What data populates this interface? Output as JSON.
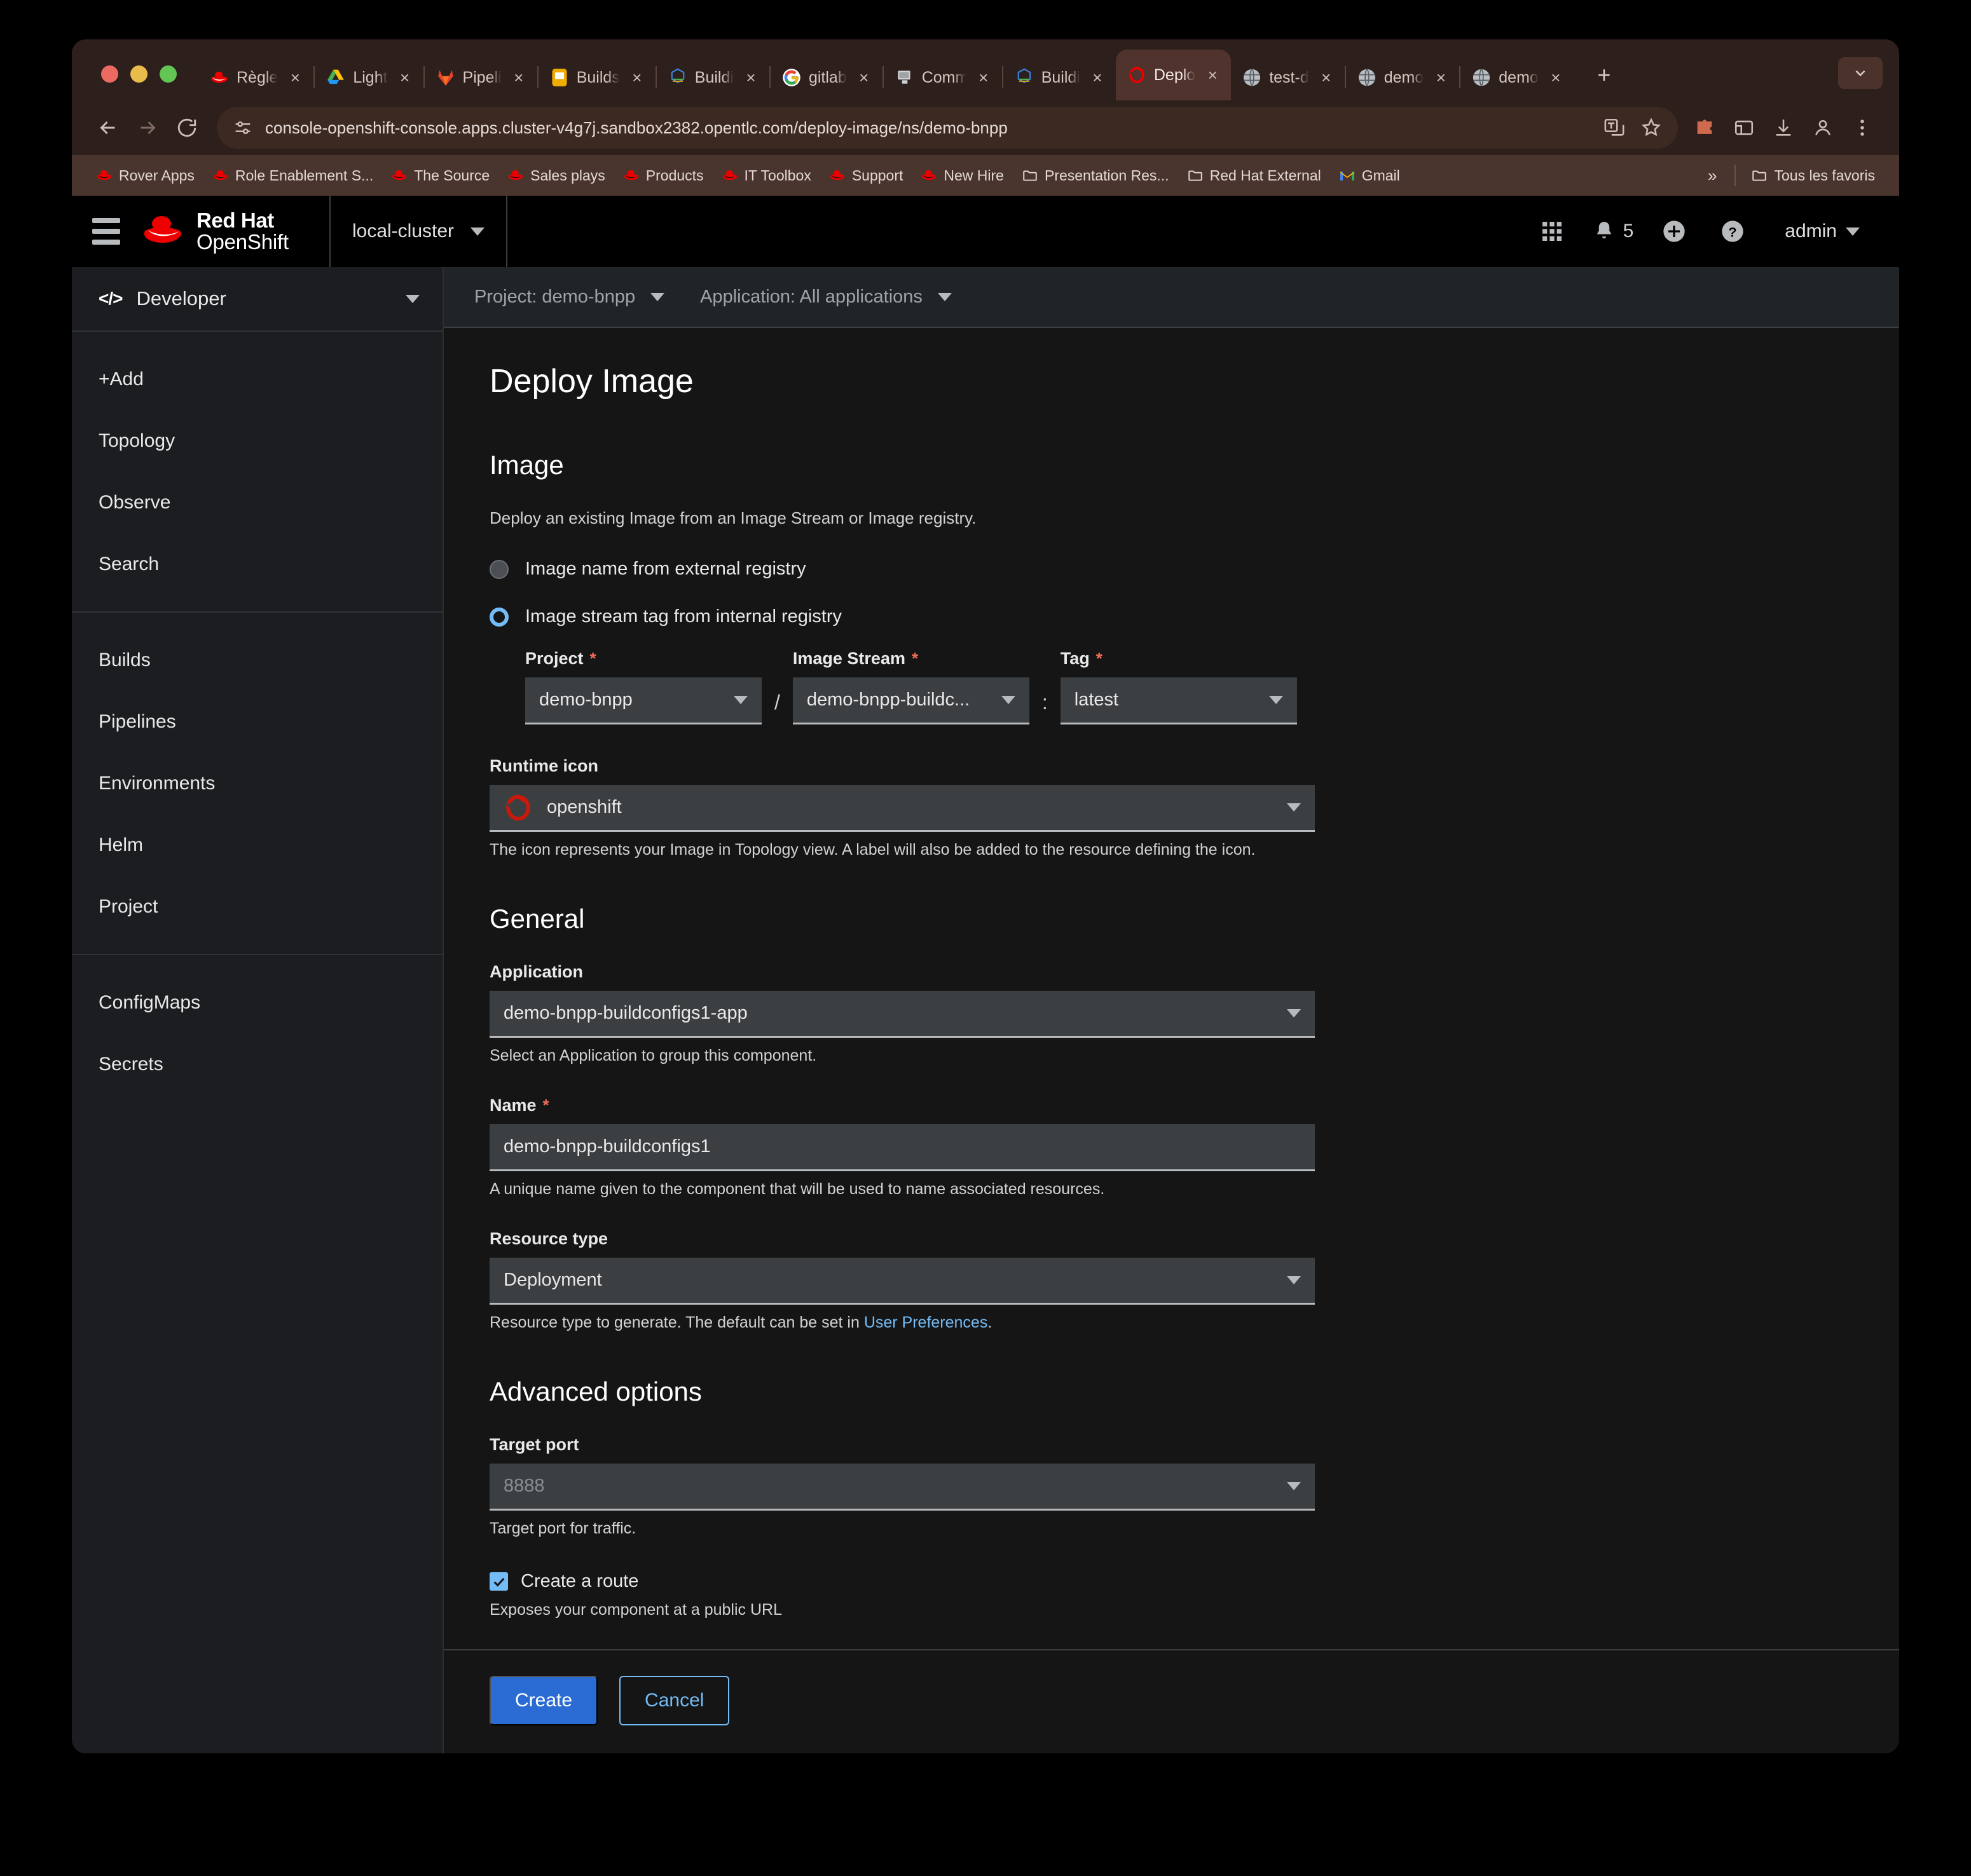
{
  "browser": {
    "tabs": [
      {
        "title": "Règle",
        "favicon": "redhat-icon",
        "active": false
      },
      {
        "title": "Light",
        "favicon": "google-drive-icon",
        "active": false
      },
      {
        "title": "Pipeli",
        "favicon": "gitlab-icon",
        "active": false
      },
      {
        "title": "Builds",
        "favicon": "yellow-note-icon",
        "active": false
      },
      {
        "title": "Buildi",
        "favicon": "tekton-icon",
        "active": false
      },
      {
        "title": "gitlab",
        "favicon": "google-icon",
        "active": false
      },
      {
        "title": "Comm",
        "favicon": "monitor-icon",
        "active": false
      },
      {
        "title": "Buildi",
        "favicon": "tekton-icon",
        "active": false
      },
      {
        "title": "Deplo",
        "favicon": "openshift-icon",
        "active": true
      },
      {
        "title": "test-d",
        "favicon": "globe-icon",
        "active": false
      },
      {
        "title": "demo",
        "favicon": "globe-icon",
        "active": false
      },
      {
        "title": "demo",
        "favicon": "globe-icon",
        "active": false
      }
    ],
    "new_tab_label": "+",
    "nav": {
      "back": "←",
      "forward": "→",
      "reload": "⟳"
    },
    "url": "console-openshift-console.apps.cluster-v4g7j.sandbox2382.opentlc.com/deploy-image/ns/demo-bnpp",
    "omnibox_icons": [
      "translate-icon",
      "bookmark-star-icon"
    ],
    "toolbar_icons": [
      "extension-puzzle-icon",
      "extensions-icon",
      "download-icon",
      "profile-avatar-icon",
      "browser-menu-icon"
    ],
    "bookmarks": [
      {
        "label": "Rover Apps",
        "icon": "redhat-icon"
      },
      {
        "label": "Role Enablement S...",
        "icon": "redhat-icon"
      },
      {
        "label": "The Source",
        "icon": "redhat-icon"
      },
      {
        "label": "Sales plays",
        "icon": "redhat-icon"
      },
      {
        "label": "Products",
        "icon": "redhat-icon"
      },
      {
        "label": "IT Toolbox",
        "icon": "redhat-icon"
      },
      {
        "label": "Support",
        "icon": "redhat-icon"
      },
      {
        "label": "New Hire",
        "icon": "redhat-icon"
      },
      {
        "label": "Presentation Res...",
        "icon": "folder-icon"
      },
      {
        "label": "Red Hat External",
        "icon": "folder-icon"
      },
      {
        "label": "Gmail",
        "icon": "gmail-icon"
      }
    ],
    "bookmarks_overflow": "»",
    "all_bookmarks": {
      "label": "Tous les favoris",
      "icon": "folder-icon"
    }
  },
  "masthead": {
    "logo_line1": "Red Hat",
    "logo_line2": "OpenShift",
    "cluster": "local-cluster",
    "notification_count": "5",
    "user": "admin",
    "icons": [
      "apps-grid-icon",
      "bell-icon",
      "plus-circle-icon",
      "help-circle-icon"
    ]
  },
  "sidebar": {
    "perspective": "Developer",
    "groups": [
      {
        "items": [
          {
            "label": "+Add"
          },
          {
            "label": "Topology"
          },
          {
            "label": "Observe"
          },
          {
            "label": "Search"
          }
        ]
      },
      {
        "items": [
          {
            "label": "Builds"
          },
          {
            "label": "Pipelines"
          },
          {
            "label": "Environments"
          },
          {
            "label": "Helm"
          },
          {
            "label": "Project"
          }
        ]
      },
      {
        "items": [
          {
            "label": "ConfigMaps"
          },
          {
            "label": "Secrets"
          }
        ]
      }
    ]
  },
  "project_bar": {
    "project": "Project: demo-bnpp",
    "application": "Application: All applications"
  },
  "page": {
    "title": "Deploy Image",
    "image_section": {
      "heading": "Image",
      "description": "Deploy an existing Image from an Image Stream or Image registry.",
      "radio_external": {
        "label": "Image name from external registry",
        "selected": false
      },
      "radio_internal": {
        "label": "Image stream tag from internal registry",
        "selected": true
      },
      "project": {
        "label": "Project",
        "required": true,
        "value": "demo-bnpp"
      },
      "separator_slash": "/",
      "image_stream": {
        "label": "Image Stream",
        "required": true,
        "value": "demo-bnpp-buildc..."
      },
      "separator_colon": ":",
      "tag": {
        "label": "Tag",
        "required": true,
        "value": "latest"
      },
      "runtime_icon": {
        "label": "Runtime icon",
        "value": "openshift",
        "icon": "openshift-icon"
      },
      "runtime_help": "The icon represents your Image in Topology view. A label will also be added to the resource defining the icon."
    },
    "general_section": {
      "heading": "General",
      "application": {
        "label": "Application",
        "value": "demo-bnpp-buildconfigs1-app",
        "help": "Select an Application to group this component."
      },
      "name": {
        "label": "Name",
        "required": true,
        "value": "demo-bnpp-buildconfigs1",
        "help": "A unique name given to the component that will be used to name associated resources."
      },
      "resource_type": {
        "label": "Resource type",
        "value": "Deployment",
        "help_prefix": "Resource type to generate. The default can be set in ",
        "help_link": "User Preferences",
        "help_suffix": "."
      }
    },
    "advanced_section": {
      "heading": "Advanced options",
      "target_port": {
        "label": "Target port",
        "placeholder": "8888",
        "help": "Target port for traffic."
      },
      "create_route": {
        "label": "Create a route",
        "checked": true,
        "help": "Exposes your component at a public URL"
      }
    },
    "footer": {
      "create": "Create",
      "cancel": "Cancel"
    }
  },
  "colors": {
    "accent_blue": "#2b6cd4",
    "link_blue": "#73bcf7",
    "required_red": "#ee6c5a",
    "redhat_red": "#e00",
    "browser_chrome": "#2d1f1b",
    "bookmarks_bg": "#4a342e"
  }
}
